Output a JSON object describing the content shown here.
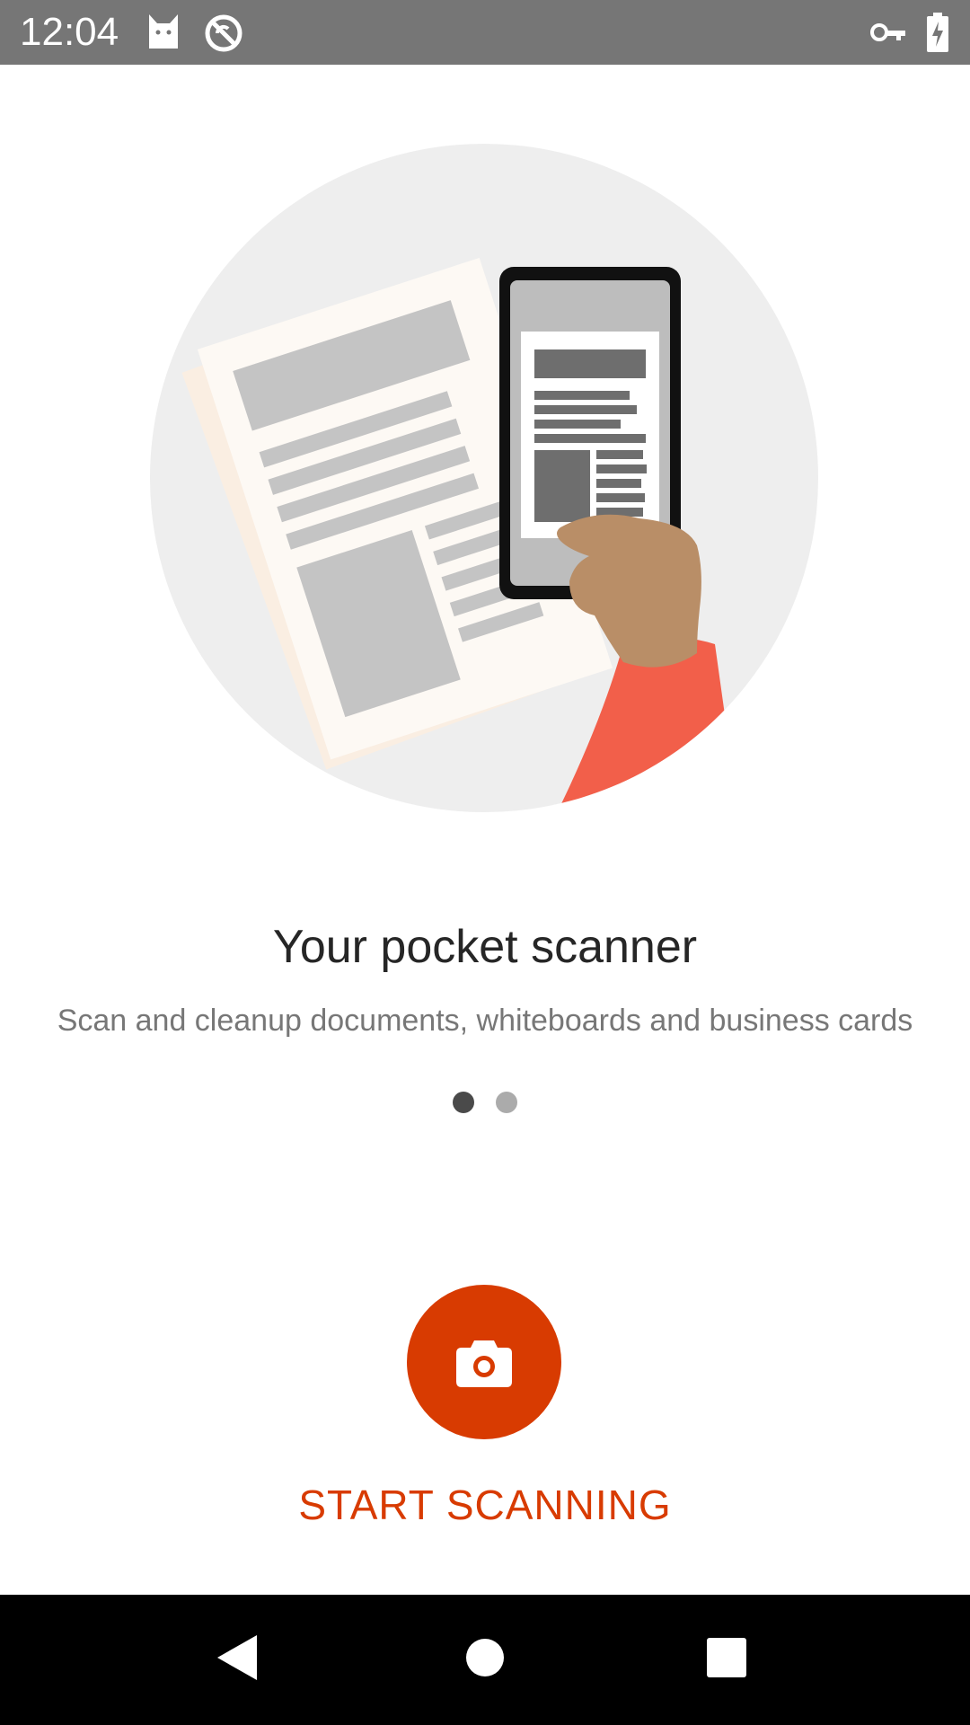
{
  "status_bar": {
    "time": "12:04",
    "left_icons": [
      "cat-icon",
      "sync-off-icon"
    ],
    "right_icons": [
      "vpn-key-icon",
      "battery-charging-icon"
    ]
  },
  "onboarding": {
    "title": "Your pocket scanner",
    "subtitle": "Scan and cleanup documents, whiteboards and business cards",
    "page_indicator": {
      "current": 1,
      "total": 2
    }
  },
  "action": {
    "fab_icon": "camera-icon",
    "label": "START SCANNING"
  },
  "nav_bar": {
    "buttons": [
      "back-icon",
      "home-icon",
      "recents-icon"
    ]
  },
  "colors": {
    "accent": "#d83b01",
    "status_bar": "#767676",
    "nav_bar": "#000000",
    "illustration_bg": "#eeeeee",
    "sleeve": "#f25f4a",
    "hand": "#b98e67"
  }
}
